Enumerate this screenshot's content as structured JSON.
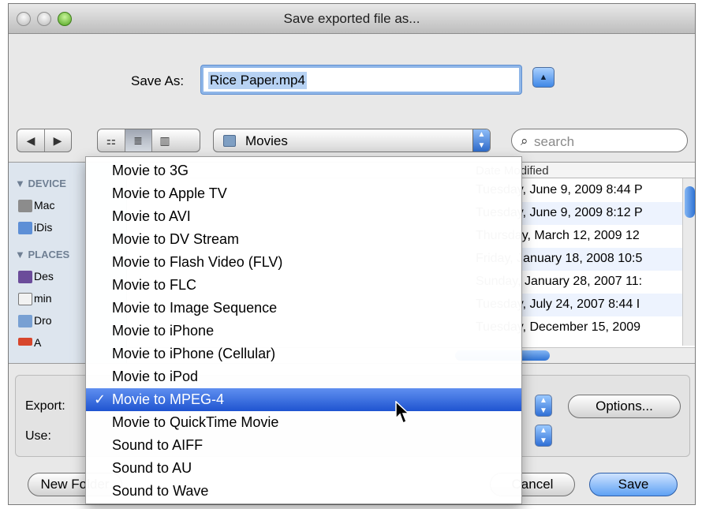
{
  "window": {
    "title": "Save exported file as..."
  },
  "saveas": {
    "label": "Save As:",
    "value": "Rice Paper.mp4"
  },
  "toolbar": {
    "back": "◀",
    "forward": "▶",
    "views": [
      "icon-view",
      "list-view",
      "column-view"
    ],
    "location": "Movies",
    "search_placeholder": "search"
  },
  "sidebar": {
    "sections": [
      {
        "label": "▼ DEVICE",
        "items": [
          "Mac",
          "iDis"
        ]
      },
      {
        "label": "▼ PLACES",
        "items": [
          "Des",
          "min",
          "Dro",
          "A"
        ]
      }
    ]
  },
  "file_list": {
    "date_header": "Date Modified",
    "dates": [
      "Tuesday, June 9, 2009 8:44 P",
      "Tuesday, June 9, 2009 8:12 P",
      "Thursday, March 12, 2009 12",
      "Friday, January 18, 2008 10:5",
      "Sunday, January 28, 2007 11:",
      "Tuesday, July 24, 2007 8:44 I",
      "Tuesday, December 15, 2009"
    ]
  },
  "export": {
    "export_label": "Export:",
    "use_label": "Use:",
    "options_label": "Options...",
    "new_folder_label": "New Folder",
    "cancel_label": "Cancel",
    "save_label": "Save"
  },
  "menu": {
    "items": [
      "Movie to 3G",
      "Movie to Apple TV",
      "Movie to AVI",
      "Movie to DV Stream",
      "Movie to Flash Video (FLV)",
      "Movie to FLC",
      "Movie to Image Sequence",
      "Movie to iPhone",
      "Movie to iPhone (Cellular)",
      "Movie to iPod",
      "Movie to MPEG-4",
      "Movie to QuickTime Movie",
      "Sound to AIFF",
      "Sound to AU",
      "Sound to Wave"
    ],
    "selected_index": 10,
    "check": "✓"
  },
  "colors": {
    "accent": "#2f6fd6",
    "selection": "#1f54d0"
  }
}
